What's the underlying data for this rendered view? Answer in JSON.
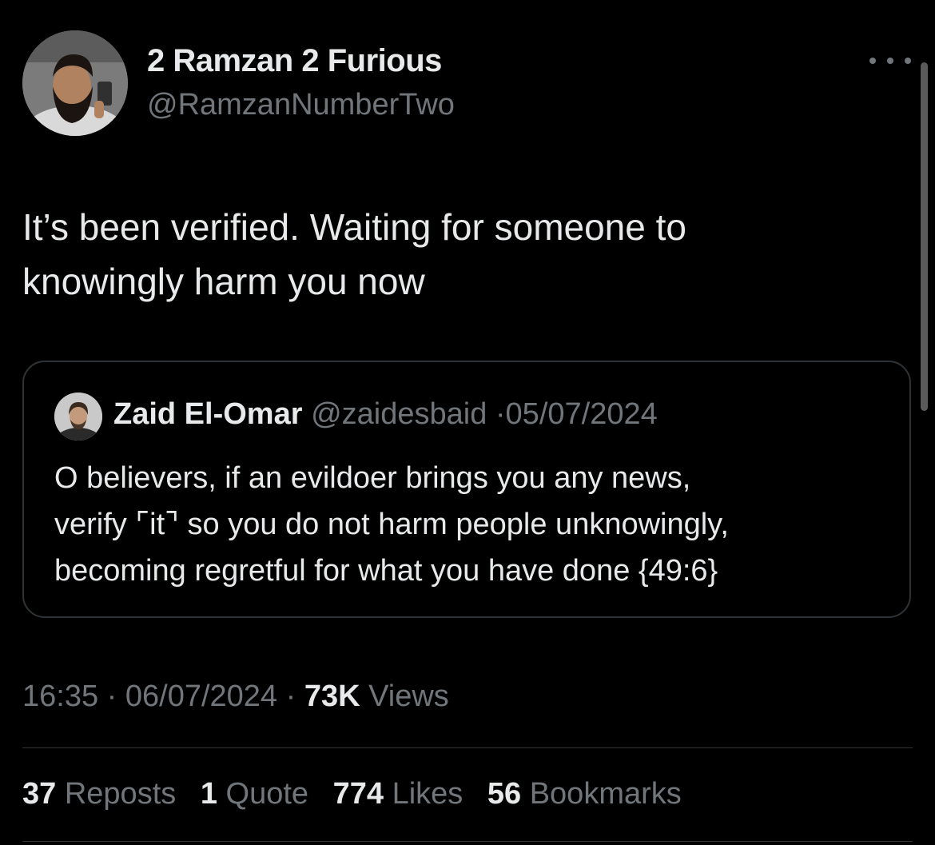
{
  "author": {
    "display_name": "2 Ramzan 2 Furious",
    "handle": "@RamzanNumberTwo"
  },
  "more_icon": "more-horizontal-icon",
  "tweet": {
    "lines": [
      "It’s been verified. Waiting for someone to",
      "knowingly harm you now"
    ]
  },
  "quoted_tweet": {
    "display_name": "Zaid El-Omar",
    "handle": "@zaidesbaid",
    "separator": "·",
    "date": "05/07/2024",
    "lines": [
      "O believers, if an evildoer brings you any news,",
      "verify ⌜it⌝ so you do not harm people unknowingly,",
      "becoming regretful for what you have done {49:6}"
    ]
  },
  "meta": {
    "time": "16:35",
    "separator": "·",
    "date": "06/07/2024",
    "views_count": "73K",
    "views_label": "Views"
  },
  "stats": {
    "reposts_count": "37",
    "reposts_label": "Reposts",
    "quotes_count": "1",
    "quotes_label": "Quote",
    "likes_count": "774",
    "likes_label": "Likes",
    "bookmarks_count": "56",
    "bookmarks_label": "Bookmarks"
  },
  "colors": {
    "background": "#000000",
    "primary_text": "#e7e9ea",
    "secondary_text": "#71767b",
    "border": "#2f3336"
  }
}
